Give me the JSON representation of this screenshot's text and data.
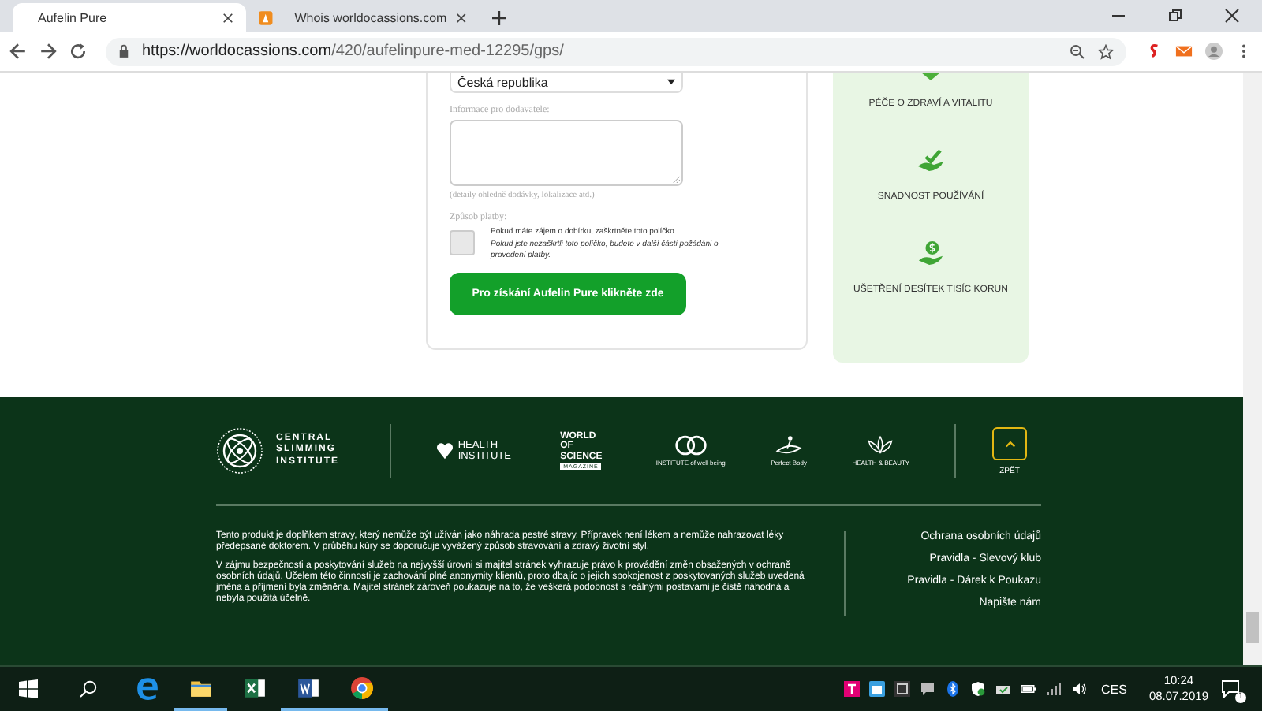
{
  "browser": {
    "tabs": [
      {
        "title": "Aufelin Pure",
        "selected": true
      },
      {
        "title": "Whois worldocassions.com",
        "selected": false
      }
    ],
    "url": {
      "host": "https://worldocassions.com",
      "path": "/420/aufelinpure-med-12295/gps/"
    }
  },
  "form": {
    "country": "Česká republika",
    "notes_label": "Informace pro dodavatele:",
    "notes_hint": "(detaily ohledně dodávky, lokalizace atd.)",
    "payment_label": "Způsob platby:",
    "cod": {
      "checked": false,
      "text": "Pokud máte zájem o dobírku, zaškrtněte toto políčko.",
      "note": "Pokud jste nezaškrtli toto políčko, budete v další části požádáni o provedení platby."
    },
    "submit": "Pro získání Aufelin Pure klikněte zde"
  },
  "benefits": [
    {
      "kind": "heart",
      "label": "PÉČE O ZDRAVÍ A VITALITU"
    },
    {
      "kind": "check",
      "label": "SNADNOST POUŽÍVÁNÍ"
    },
    {
      "kind": "coin",
      "label": "UŠETŘENÍ DESÍTEK TISÍC KORUN"
    }
  ],
  "footer": {
    "brand": [
      "CENTRAL",
      "SLIMMING",
      "INSTITUTE"
    ],
    "partners": [
      {
        "kind": "health",
        "text": "HEALTH INSTITUTE"
      },
      {
        "kind": "science",
        "text": "WORLD OF SCIENCE",
        "sub": "MAGAZINE"
      },
      {
        "kind": "wellbeing",
        "text": "INSTITUTE of well being"
      },
      {
        "kind": "body",
        "text": "Perfect Body"
      },
      {
        "kind": "beauty",
        "text": "HEALTH & BEAUTY"
      }
    ],
    "back": "ZPĚT",
    "paragraphs": [
      "Tento produkt je doplňkem stravy, který nemůže být užíván jako náhrada pestré stravy. Přípravek není lékem a nemůže nahrazovat léky předepsané doktorem. V průběhu kúry se doporučuje vyvážený způsob stravování a zdravý životní styl.",
      "V zájmu bezpečnosti a poskytování služeb na nejvyšší úrovni si majitel stránek vyhrazuje právo k provádění změn obsažených v ochraně osobních údajů. Účelem této činnosti je zachování plné anonymity klientů, proto dbajíc o jejich spokojenost z poskytovaných služeb uvedená jména a příjmení byla změněna. Majitel stránek zároveň poukazuje na to, že veškerá podobnost s reálnými postavami je čistě náhodná a nebyla použitá účelně."
    ],
    "links": [
      "Ochrana osobních údajů",
      "Pravidla - Slevový klub",
      "Pravidla - Dárek k Poukazu",
      "Napište nám"
    ]
  },
  "taskbar": {
    "apps": [
      {
        "kind": "edge",
        "active": false
      },
      {
        "kind": "folder",
        "active": true
      },
      {
        "kind": "excel",
        "active": false
      },
      {
        "kind": "word",
        "active": true
      },
      {
        "kind": "chrome",
        "active": true
      }
    ],
    "language": "CES",
    "time": "10:24",
    "date": "08.07.2019",
    "notifications": "1"
  }
}
